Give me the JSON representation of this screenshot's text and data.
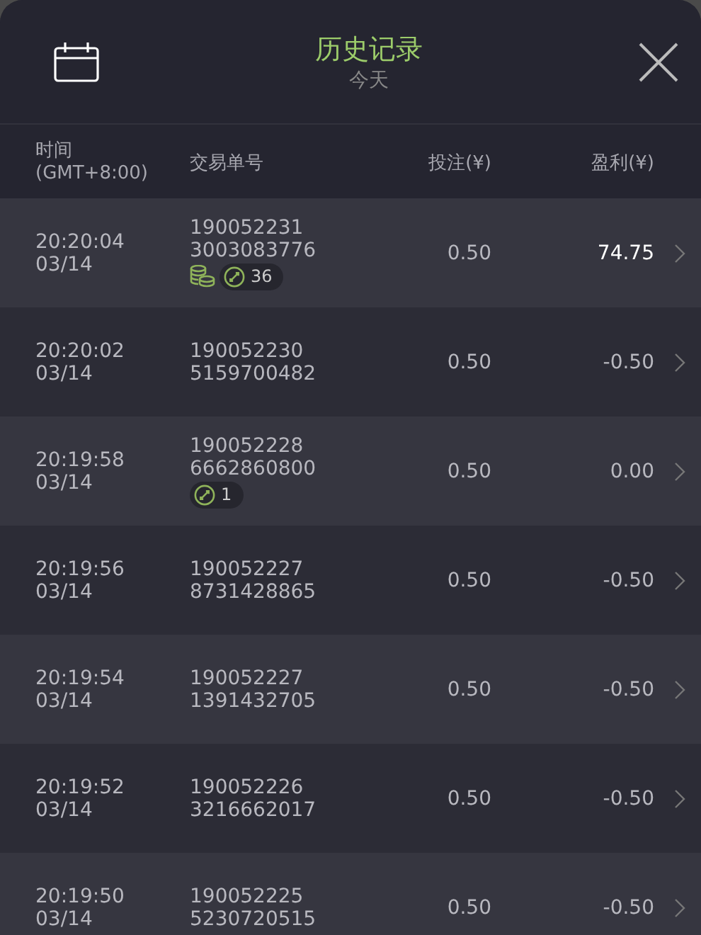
{
  "header": {
    "title": "历史记录",
    "subtitle": "今天"
  },
  "columns": [
    {
      "label": "时间",
      "sub": "(GMT+8:00)"
    },
    {
      "label": "交易单号"
    },
    {
      "label": "投注(¥)"
    },
    {
      "label": "盈利(¥)"
    }
  ],
  "rows": [
    {
      "time": "20:20:04",
      "date": "03/14",
      "order_1": "190052231",
      "order_2": "3003083776",
      "bet": "0.50",
      "profit": "74.75",
      "win": true,
      "coins": true,
      "badge_count": "36"
    },
    {
      "time": "20:20:02",
      "date": "03/14",
      "order_1": "190052230",
      "order_2": "5159700482",
      "bet": "0.50",
      "profit": "-0.50",
      "win": false,
      "coins": false
    },
    {
      "time": "20:19:58",
      "date": "03/14",
      "order_1": "190052228",
      "order_2": "6662860800",
      "bet": "0.50",
      "profit": "0.00",
      "win": false,
      "coins": false,
      "badge_count": "1"
    },
    {
      "time": "20:19:56",
      "date": "03/14",
      "order_1": "190052227",
      "order_2": "8731428865",
      "bet": "0.50",
      "profit": "-0.50",
      "win": false,
      "coins": false
    },
    {
      "time": "20:19:54",
      "date": "03/14",
      "order_1": "190052227",
      "order_2": "1391432705",
      "bet": "0.50",
      "profit": "-0.50",
      "win": false,
      "coins": false
    },
    {
      "time": "20:19:52",
      "date": "03/14",
      "order_1": "190052226",
      "order_2": "3216662017",
      "bet": "0.50",
      "profit": "-0.50",
      "win": false,
      "coins": false
    },
    {
      "time": "20:19:50",
      "date": "03/14",
      "order_1": "190052225",
      "order_2": "5230720515",
      "bet": "0.50",
      "profit": "-0.50",
      "win": false,
      "coins": false
    }
  ]
}
